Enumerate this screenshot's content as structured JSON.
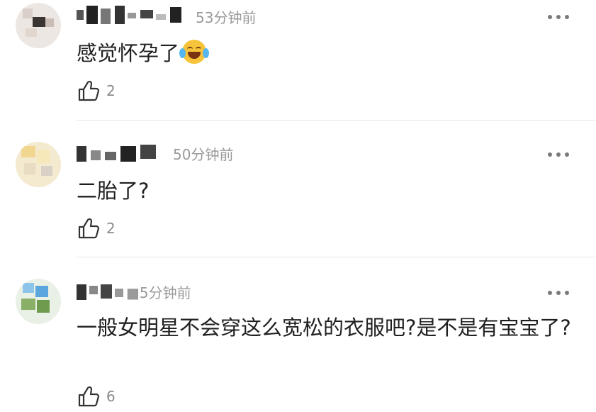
{
  "comments": [
    {
      "time": "53分钟前",
      "text": "感觉怀孕了",
      "emoji": "laughing-crying-emoji",
      "likes": "2"
    },
    {
      "time": "50分钟前",
      "text": "二胎了?",
      "likes": "2"
    },
    {
      "time": "45分钟前",
      "time_visible": "■5分钟前",
      "text": "一般女明星不会穿这么宽松的衣服吧?是不是有宝宝了?",
      "likes": "6"
    }
  ],
  "icons": {
    "more": "more-dots-icon",
    "like": "thumbs-up-icon"
  },
  "colors": {
    "text": "#1f1f1f",
    "meta": "#9a9a9a",
    "divider": "#e6e6e6"
  }
}
